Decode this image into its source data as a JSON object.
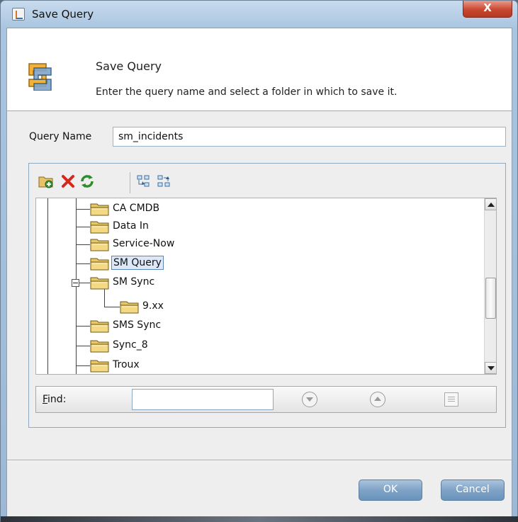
{
  "window": {
    "title": "Save Query",
    "close_label": "X"
  },
  "header": {
    "title": "Save Query",
    "subtitle": "Enter the query name and select a folder in which to save it."
  },
  "form": {
    "query_name_label": "Query Name",
    "query_name_value": "sm_incidents"
  },
  "toolbar": {
    "icons": [
      "new-folder-icon",
      "delete-icon",
      "refresh-icon",
      "expand-all-icon",
      "collapse-all-icon"
    ]
  },
  "tree": {
    "nodes": [
      {
        "label": "CA CMDB"
      },
      {
        "label": "Data In"
      },
      {
        "label": "Service-Now"
      },
      {
        "label": "SM Query",
        "selected": true
      },
      {
        "label": "SM Sync",
        "expanded": true
      },
      {
        "label": "9.xx"
      },
      {
        "label": "SMS Sync"
      },
      {
        "label": "Sync_8"
      },
      {
        "label": "Troux"
      }
    ]
  },
  "find": {
    "label": "Find:",
    "value": ""
  },
  "buttons": {
    "ok": "OK",
    "cancel": "Cancel"
  },
  "colors": {
    "selection": "#dce8f7",
    "button": "#7fa3c7",
    "close": "#c9462f"
  }
}
